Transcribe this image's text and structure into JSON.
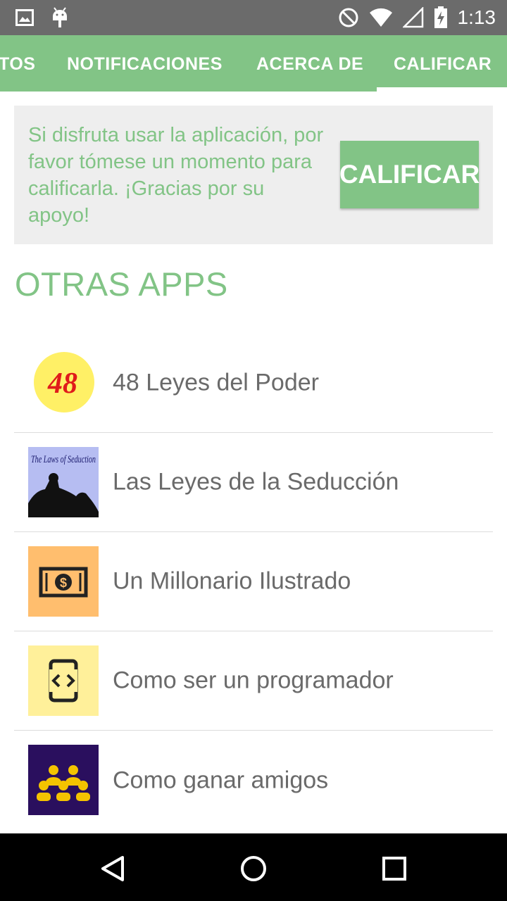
{
  "status_bar": {
    "time": "1:13",
    "icons": [
      "image-icon",
      "android-icon",
      "do-not-disturb-icon",
      "wifi-icon",
      "signal-icon",
      "battery-charging-icon"
    ]
  },
  "tabs": [
    {
      "label": "TOS",
      "selected": false
    },
    {
      "label": "NOTIFICACIONES",
      "selected": false
    },
    {
      "label": "ACERCA DE",
      "selected": false
    },
    {
      "label": "CALIFICAR",
      "selected": true
    }
  ],
  "rate_card": {
    "message": "Si disfruta usar la aplicación, por favor tómese un momento para calificarla. ¡Gracias por su apoyo!",
    "button_label": "CALIFICAR"
  },
  "other_apps": {
    "title": "OTRAS APPS",
    "items": [
      {
        "name": "48 Leyes del Poder",
        "icon": "48-laws-icon",
        "icon_text": "48"
      },
      {
        "name": "Las Leyes de la Seducción",
        "icon": "laws-of-seduction-icon",
        "icon_text": "The Laws of Seduction"
      },
      {
        "name": "Un Millonario Ilustrado",
        "icon": "dollar-bill-icon"
      },
      {
        "name": "Como ser un programador",
        "icon": "code-device-icon"
      },
      {
        "name": "Como ganar amigos",
        "icon": "group-people-icon"
      }
    ]
  },
  "colors": {
    "accent": "#82c486",
    "status_bar": "#6b6b6b",
    "card_bg": "#eeeeee",
    "text_gray": "#6a6a6a"
  },
  "nav": [
    "back-icon",
    "home-icon",
    "recents-icon"
  ]
}
